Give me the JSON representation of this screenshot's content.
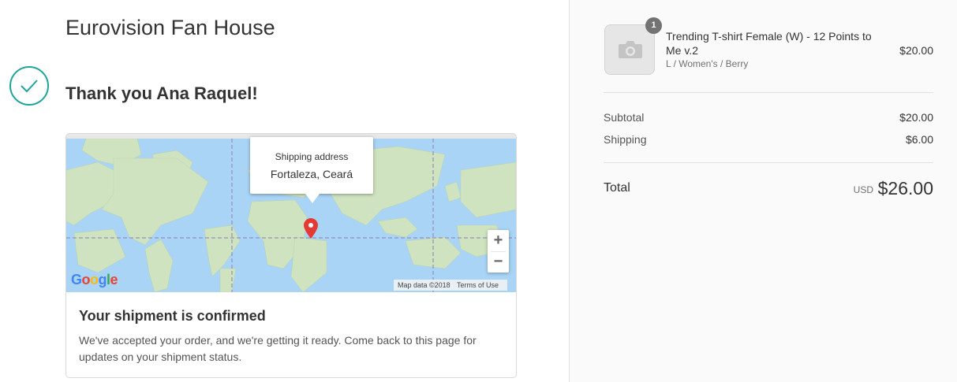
{
  "shop": {
    "name": "Eurovision Fan House"
  },
  "thank_you": {
    "text": "Thank you Ana Raquel!"
  },
  "map": {
    "popup_label": "Shipping address",
    "popup_value": "Fortaleza, Ceará",
    "zoom_in": "+",
    "zoom_out": "−",
    "logo": {
      "G": "G",
      "o1": "o",
      "o2": "o",
      "g": "g",
      "l": "l",
      "e": "e"
    },
    "attribution_data": "Map data ©2018",
    "attribution_terms": "Terms of Use"
  },
  "shipment": {
    "title": "Your shipment is confirmed",
    "text": "We've accepted your order, and we're getting it ready. Come back to this page for updates on your shipment status."
  },
  "order": {
    "item": {
      "quantity": "1",
      "name": "Trending T-shirt Female (W) - 12 Points to Me v.2",
      "variant": "L / Women's / Berry",
      "price": "$20.00",
      "image_icon": "camera-icon"
    },
    "subtotal_label": "Subtotal",
    "subtotal_value": "$20.00",
    "shipping_label": "Shipping",
    "shipping_value": "$6.00",
    "total_label": "Total",
    "total_currency": "USD",
    "total_value": "$26.00"
  },
  "colors": {
    "accent": "#1ea59a",
    "ocean": "#a9d4f5",
    "land": "#cfe3c0",
    "pin": "#e53935"
  }
}
